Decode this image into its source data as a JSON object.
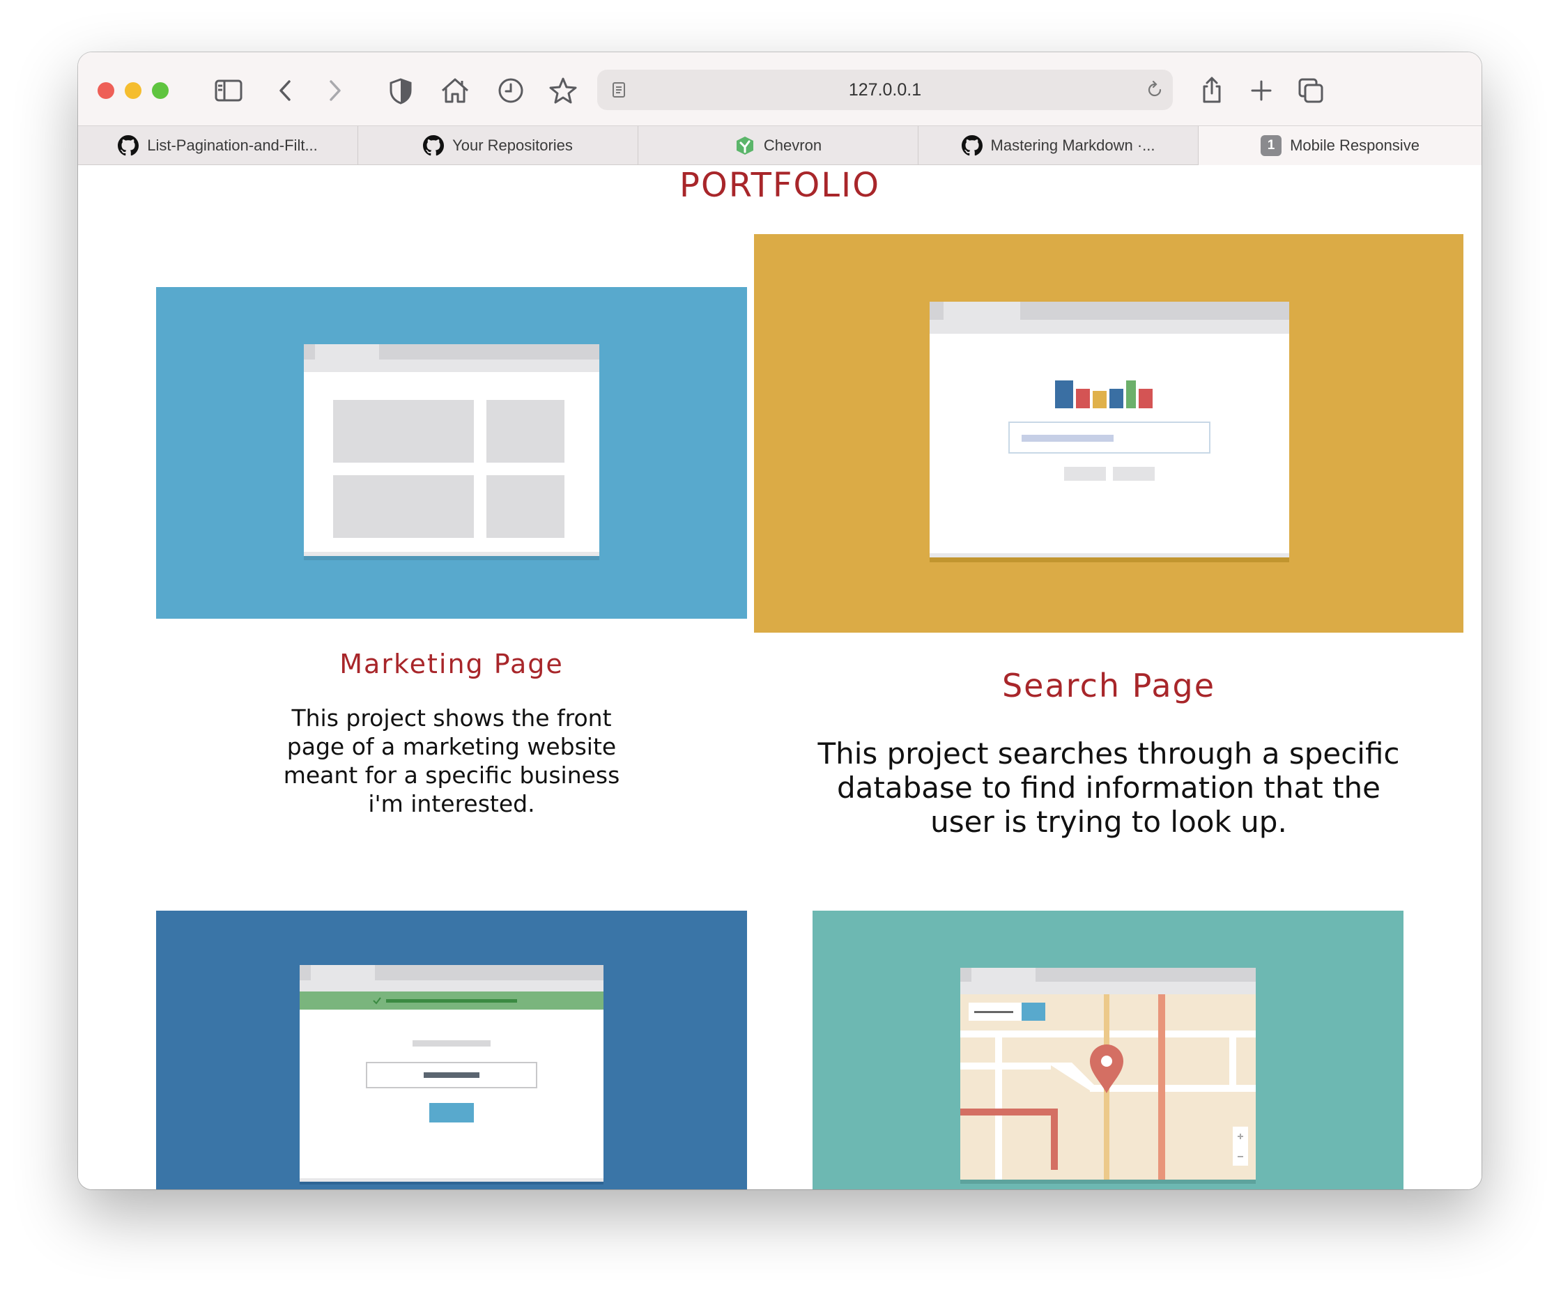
{
  "browser": {
    "address": "127.0.0.1",
    "tabs": [
      {
        "label": "List-Pagination-and-Filt...",
        "favicon": "github-icon"
      },
      {
        "label": "Your Repositories",
        "favicon": "github-icon"
      },
      {
        "label": "Chevron",
        "favicon": "chevron-logo-icon"
      },
      {
        "label": "Mastering Markdown ·...",
        "favicon": "github-icon"
      },
      {
        "label": "Mobile Responsive",
        "favicon": "numbered-badge",
        "badge": "1",
        "active": true
      }
    ],
    "toolbar_icons": [
      "sidebar-icon",
      "back-icon",
      "forward-icon",
      "shield-icon",
      "home-icon",
      "history-icon",
      "bookmark-star-icon",
      "share-icon",
      "new-tab-plus-icon",
      "tab-overview-icon"
    ]
  },
  "page": {
    "title": "PORTFOLIO",
    "projects": [
      {
        "title": "Marketing Page",
        "description": "This project shows the front page of a marketing website meant for a specific business i'm interested.",
        "thumbnail_color": "#58a9cd"
      },
      {
        "title": "Search Page",
        "description": "This project searches through a specific database to find information that the user is trying to look up.",
        "thumbnail_color": "#dbab46"
      },
      {
        "title": "",
        "description": "",
        "thumbnail_color": "#3a75a7"
      },
      {
        "title": "",
        "description": "",
        "thumbnail_color": "#6db8b2"
      }
    ]
  },
  "colors": {
    "accent": "#a8262a",
    "close": "#ee5f57",
    "minimize": "#f5bd2f",
    "zoom": "#5fc43f"
  }
}
